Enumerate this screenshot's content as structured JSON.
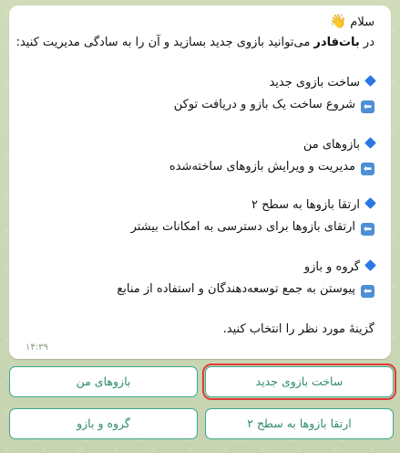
{
  "message": {
    "greeting": "سلام",
    "intro_bold": "بات‌فادر",
    "intro_rest": " می‌توانید بازوی جدید بسازید و آن را به سادگی مدیریت کنید:",
    "intro_prefix": "در ",
    "sections": [
      {
        "title": "ساخت بازوی جدید",
        "desc": "شروع ساخت یک بازو و دریافت توکن"
      },
      {
        "title": "بازوهای من",
        "desc": "مدیریت و ویرایش بازوهای ساخته‌شده"
      },
      {
        "title": "ارتقا بازوها به سطح ۲",
        "desc": "ارتقای بازوها برای دسترسی به امکانات بیشتر"
      },
      {
        "title": "گروه و بازو",
        "desc": "پیوستن به جمع توسعه‌دهندگان و استفاده از منابع"
      }
    ],
    "footer": "گزینهٔ مورد نظر را انتخاب کنید.",
    "time": "۱۴:۳۹"
  },
  "keyboard": {
    "buttons": [
      {
        "label": "ساخت بازوی جدید"
      },
      {
        "label": "بازوهای من"
      },
      {
        "label": "ارتقا بازوها به سطح ۲"
      },
      {
        "label": "گروه و بازو"
      }
    ]
  },
  "colors": {
    "accent": "#2e8b72",
    "button_border": "#3aa88b",
    "bullet": "#2b78e4",
    "highlight": "#e03a3a"
  },
  "icons": {
    "bullet": "blue-diamond-icon",
    "arrow": "left-arrow-icon",
    "greeting": "waving-hand-icon"
  }
}
